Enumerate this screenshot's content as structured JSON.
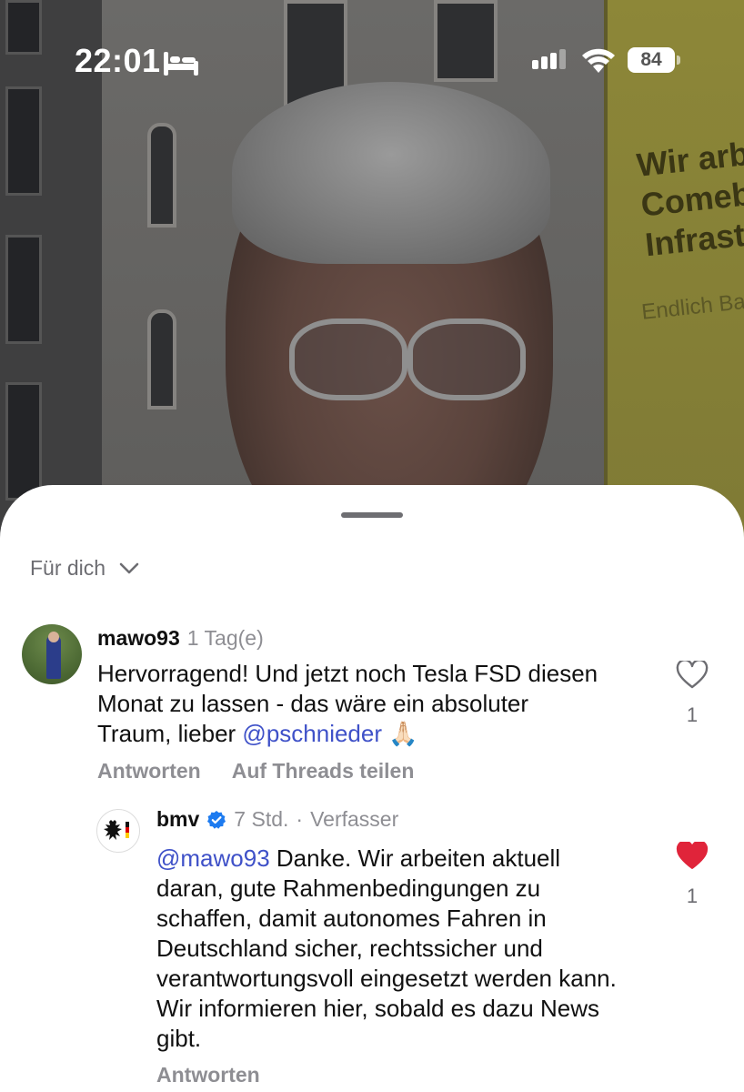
{
  "status_bar": {
    "time": "22:01",
    "battery": "84"
  },
  "photo": {
    "sign_lines": [
      "Wir arbeit",
      "Comebac",
      "Infrastru"
    ],
    "sign_sub": "Endlich Bau"
  },
  "sheet": {
    "filter_label": "Für dich"
  },
  "comments": [
    {
      "username": "mawo93",
      "time": "1 Tag(e)",
      "text_before_mention": "Hervorragend! Und jetzt noch Tesla FSD diesen Monat zu lassen - das wäre ein absoluter Traum, lieber ",
      "mention": "@pschnieder",
      "text_after_mention": " 🙏🏻",
      "reply_label": "Antworten",
      "share_label": "Auf Threads teilen",
      "likes": "1",
      "liked": false
    },
    {
      "username": "bmv",
      "verified": true,
      "time": "7 Std.",
      "separator": "·",
      "author_badge": "Verfasser",
      "mention": "@mawo93",
      "text": " Danke. Wir arbeiten aktuell daran, gute Rahmenbedingungen zu schaffen, damit autonomes Fahren in Deutschland sicher, rechtssicher und verantwortungsvoll eingesetzt werden kann.  Wir informieren hier, sobald es dazu News gibt.",
      "reply_label": "Antworten",
      "likes": "1",
      "liked": true
    }
  ],
  "colors": {
    "mention": "#3f51c8",
    "like_active": "#e0243a",
    "muted": "#8e8e93"
  }
}
